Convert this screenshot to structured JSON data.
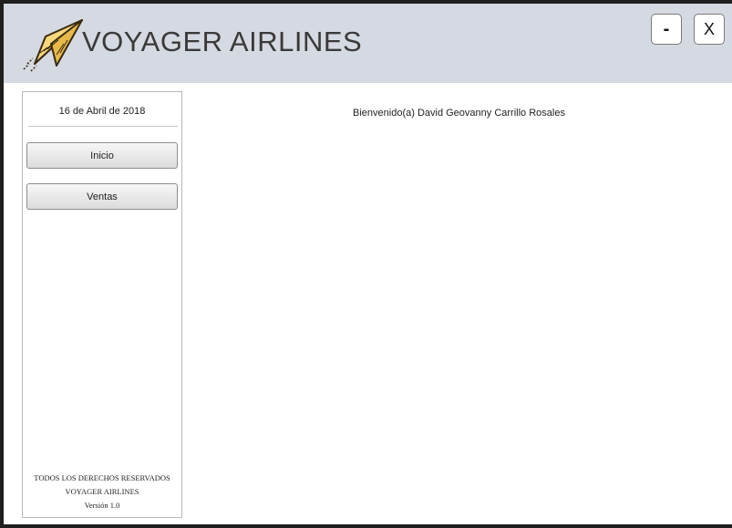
{
  "header": {
    "app_title": "VOYAGER AIRLINES",
    "logo_icon": "paper-plane-icon",
    "minimize_label": "-",
    "close_label": "X"
  },
  "sidebar": {
    "date": "16 de Abril de 2018",
    "buttons": [
      {
        "label": "Inicio"
      },
      {
        "label": "Ventas"
      }
    ],
    "footer": {
      "line1": "TODOS LOS DERECHOS RESERVADOS",
      "line2": "VOYAGER AIRLINES",
      "line3": "Versión 1.0"
    }
  },
  "main": {
    "welcome": "Bienvenido(a) David Geovanny Carrillo Rosales"
  },
  "colors": {
    "header_bg": "#d5d9e1",
    "logo_plane": "#f2c85a",
    "logo_outline": "#3a2a10"
  }
}
